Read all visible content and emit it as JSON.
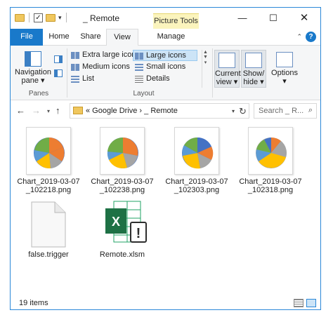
{
  "window": {
    "title": "_ Remote",
    "context_tab_group": "Picture Tools",
    "controls": {
      "minimize": "—",
      "maximize": "☐",
      "close": "✕"
    }
  },
  "tabs": [
    {
      "label": "File"
    },
    {
      "label": "Home"
    },
    {
      "label": "Share"
    },
    {
      "label": "View",
      "active": true
    },
    {
      "label": "Manage"
    }
  ],
  "ribbon": {
    "panes_group": {
      "navigation_pane_label": "Navigation",
      "navigation_pane_label2": "pane ▾",
      "group_label": "Panes"
    },
    "layout_group": {
      "items": [
        {
          "label": "Extra large icons"
        },
        {
          "label": "Large icons",
          "selected": true
        },
        {
          "label": "Medium icons"
        },
        {
          "label": "Small icons"
        },
        {
          "label": "List"
        },
        {
          "label": "Details"
        }
      ],
      "group_label": "Layout"
    },
    "current_view": {
      "line1": "Current",
      "line2": "view ▾"
    },
    "show_hide": {
      "line1": "Show/",
      "line2": "hide ▾"
    },
    "options": {
      "line1": "Options",
      "line2": "▾"
    }
  },
  "address": {
    "path": "«  Google Drive  ›  _ Remote",
    "search_placeholder": "Search _ R..."
  },
  "files": [
    {
      "name": "Chart_2019-03-07 _102218.png",
      "type": "png"
    },
    {
      "name": "Chart_2019-03-07 _102238.png",
      "type": "png"
    },
    {
      "name": "Chart_2019-03-07 _102303.png",
      "type": "png"
    },
    {
      "name": "Chart_2019-03-07 _102318.png",
      "type": "png"
    },
    {
      "name": "false.trigger",
      "type": "generic"
    },
    {
      "name": "Remote.xlsm",
      "type": "excel"
    }
  ],
  "status": {
    "item_count": "19 items"
  },
  "colors": {
    "accent": "#1979ca",
    "picture_tools": "#fbf4bd",
    "excel_green": "#1e7145"
  }
}
